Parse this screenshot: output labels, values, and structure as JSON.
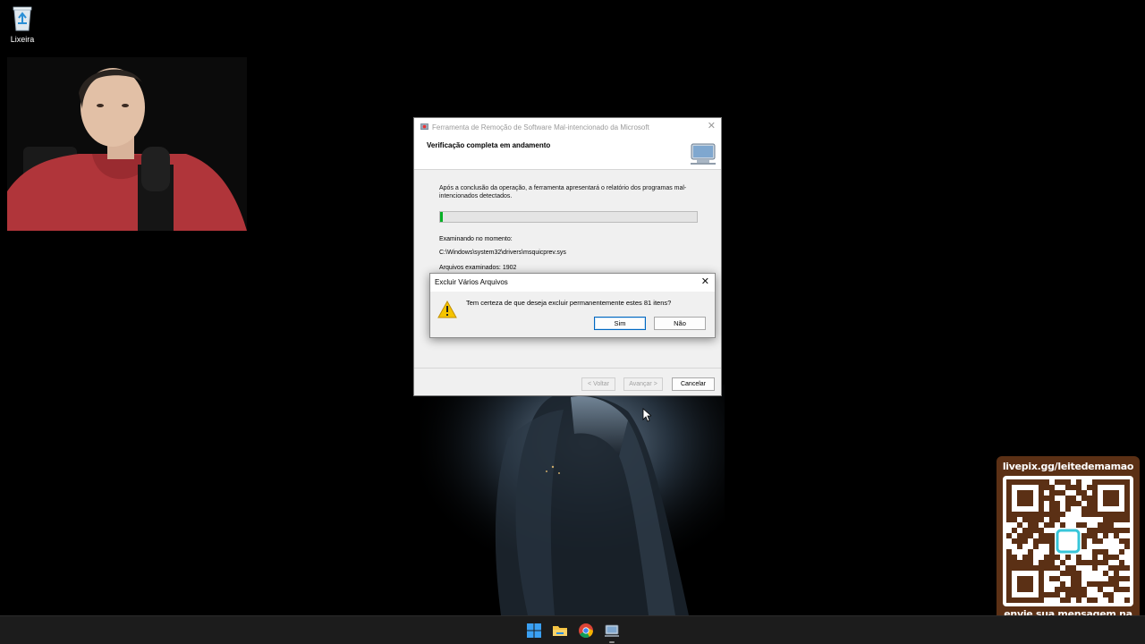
{
  "desktop": {
    "icons": [
      {
        "label": "Lixeira",
        "icon": "recycle-bin-icon"
      }
    ]
  },
  "msrt_window": {
    "title": "Ferramenta de Remoção de Software Mal-intencionado da Microsoft",
    "close_glyph": "✕",
    "heading": "Verificação completa  em andamento",
    "description": "Após a conclusão da operação, a ferramenta apresentará o relatório dos programas mal-intencionados detectados.",
    "progress_fraction": 0.01,
    "scanning_label": "Examinando no momento:",
    "scanning_path": "C:\\Windows\\system32\\drivers\\msquicprev.sys",
    "scanned_count": "Arquivos examinados: 1902",
    "buttons": {
      "back": "< Voltar",
      "next": "Avançar >",
      "cancel": "Cancelar"
    }
  },
  "confirm_dialog": {
    "title": "Excluir Vários Arquivos",
    "close_glyph": "✕",
    "message": "Tem certeza de que deseja excluir permanentemente estes 81 itens?",
    "icon": "warning-icon",
    "buttons": {
      "yes": "Sim",
      "no": "Não"
    }
  },
  "stream_overlay": {
    "url": "livepix.gg/leitedemamao",
    "message": "envie sua mensagem na live via pix!"
  },
  "taskbar": {
    "items": [
      "start-icon",
      "file-explorer-icon",
      "chrome-icon",
      "msrt-icon"
    ]
  },
  "colors": {
    "progress": "#06b025",
    "overlay_brown": "#5b3015",
    "default_button_border": "#0067c0",
    "taskbar": "#1c1c1c"
  }
}
